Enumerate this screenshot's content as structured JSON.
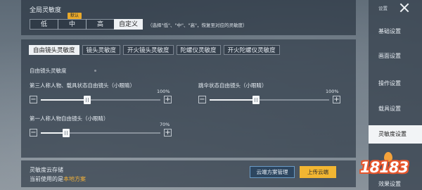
{
  "global": {
    "title": "全局灵敏度",
    "presets": [
      "低",
      "中",
      "高",
      "自定义"
    ],
    "default_badge": "默认",
    "selected": "自定义",
    "hint": "（选择\"低\"、\"中\"、\"高\"，恢复至对应的灵敏度）"
  },
  "tabs": [
    "自由镜头灵敏度",
    "镜头灵敏度",
    "开火镜头灵敏度",
    "陀螺仪灵敏度",
    "开火陀螺仪灵敏度"
  ],
  "active_tab": "自由镜头灵敏度",
  "section_title": "自由镜头灵敏度",
  "sliders": [
    {
      "label": "第三人称人物、载具状态自由镜头（小眼睛）",
      "value_text": "100%",
      "fraction": 0.39
    },
    {
      "label": "跳伞状态自由镜头（小眼睛）",
      "value_text": "100%",
      "fraction": 0.39
    },
    {
      "label": "第一人称人物自由镜头（小眼睛）",
      "value_text": "70%",
      "fraction": 0.21
    }
  ],
  "cloud": {
    "title": "灵敏度云存储",
    "current_prefix": "当前使用的是",
    "current_scheme": "本地方案",
    "manage_label": "云端方案管理",
    "upload_label": "上传云端"
  },
  "sidebar": {
    "head": "设置",
    "items": [
      "基础设置",
      "画面设置",
      "操作设置",
      "载具设置",
      "灵敏度设置",
      "效果设置"
    ],
    "active": "灵敏度设置"
  },
  "colors": {
    "accent": "#f2b632",
    "scheme_text": "#f0b03a",
    "badge": "#e9a92a"
  },
  "watermark": "18183"
}
